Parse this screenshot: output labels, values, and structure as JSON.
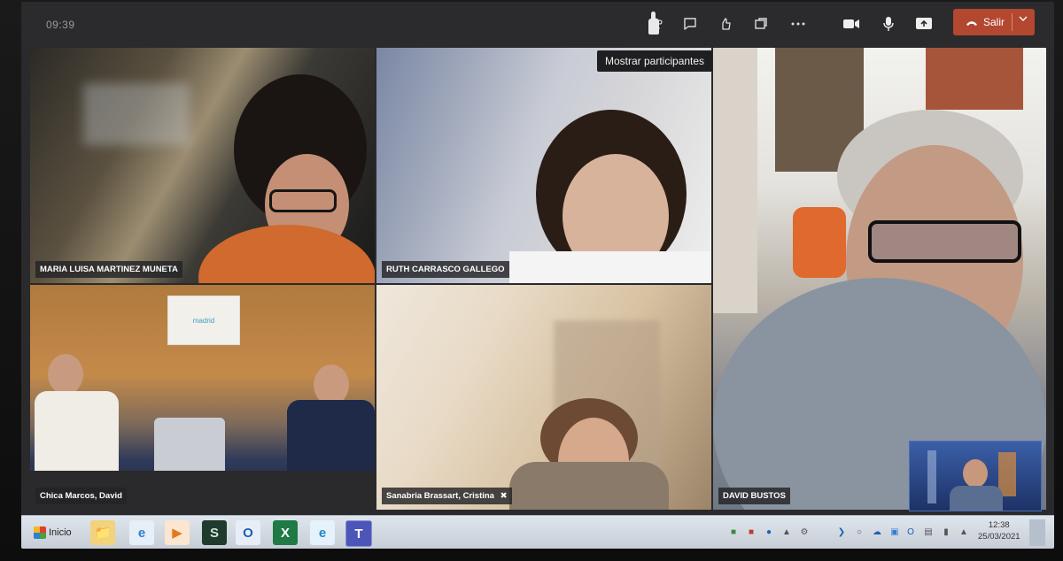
{
  "top_bar": {
    "clock": "09:39",
    "tooltip": "Mostrar participantes",
    "leave_label": "Salir",
    "icons": [
      "participants-icon",
      "chat-icon",
      "reactions-icon",
      "rooms-icon",
      "more-icon",
      "camera-icon",
      "mic-icon",
      "share-icon"
    ]
  },
  "participants": [
    {
      "name": "MARIA LUISA MARTINEZ MUNETA"
    },
    {
      "name": "RUTH CARRASCO GALLEGO"
    },
    {
      "name": "DAVID BUSTOS"
    },
    {
      "name": "Chica Marcos, David"
    },
    {
      "name": "Sanabria Brassart, Cristina"
    }
  ],
  "room_sign": "madrid",
  "taskbar": {
    "start_label": "Inicio",
    "time": "12:38",
    "date": "25/03/2021"
  },
  "colors": {
    "leave_button": "#b3472f",
    "top_bar": "#2b2b2e",
    "taskbar": "#d4dae2"
  }
}
